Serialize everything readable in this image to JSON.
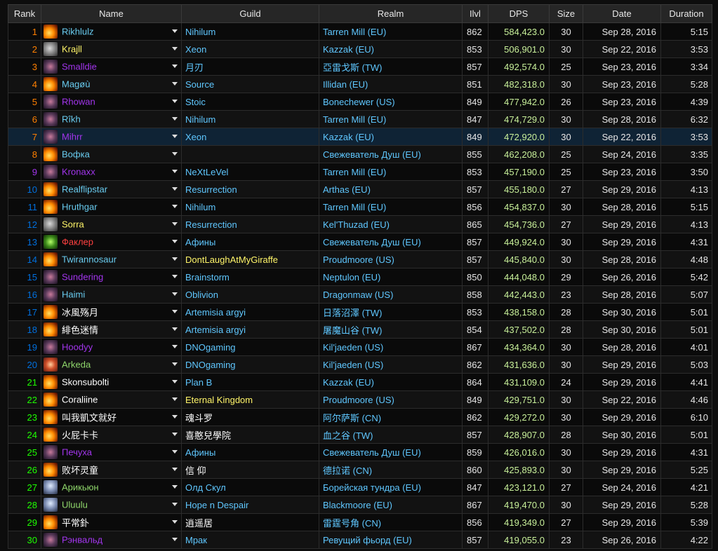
{
  "headers": {
    "rank": "Rank",
    "name": "Name",
    "guild": "Guild",
    "realm": "Realm",
    "ilvl": "Ilvl",
    "dps": "DPS",
    "size": "Size",
    "date": "Date",
    "duration": "Duration"
  },
  "colors": {
    "mage": "#69ccf0",
    "warrior": "#c79c6e",
    "dh": "#a330c9",
    "warlock": "#9482c9",
    "dk": "#c41f3b",
    "priest": "#ffffff",
    "legendary": "#ff8000",
    "rare_guild": "#5fc7ff"
  },
  "rows": [
    {
      "rank": "1",
      "name": "Rikhlulz",
      "name_color": "#69ccf0",
      "icon": "fire-icon",
      "guild": "Nihilum",
      "guild_color": "#5fc7ff",
      "realm": "Tarren Mill (EU)",
      "ilvl": "862",
      "dps": "584,423.0",
      "size": "30",
      "date": "Sep 28, 2016",
      "duration": "5:15"
    },
    {
      "rank": "2",
      "name": "Krajll",
      "name_color": "#fff569",
      "icon": "warrior-helm-icon",
      "guild": "Xeon",
      "guild_color": "#5fc7ff",
      "realm": "Kazzak (EU)",
      "ilvl": "853",
      "dps": "506,901.0",
      "size": "30",
      "date": "Sep 22, 2016",
      "duration": "3:53"
    },
    {
      "rank": "3",
      "name": "Smalldie",
      "name_color": "#a335ee",
      "icon": "demon-hunter-icon",
      "guild": "月刃",
      "guild_color": "#5fc7ff",
      "realm": "亞雷戈斯 (TW)",
      "ilvl": "857",
      "dps": "492,574.0",
      "size": "25",
      "date": "Sep 23, 2016",
      "duration": "3:34"
    },
    {
      "rank": "4",
      "name": "Magøù",
      "name_color": "#69ccf0",
      "icon": "fire-icon",
      "guild": "Source",
      "guild_color": "#5fc7ff",
      "realm": "Illidan (EU)",
      "ilvl": "851",
      "dps": "482,318.0",
      "size": "30",
      "date": "Sep 23, 2016",
      "duration": "5:28"
    },
    {
      "rank": "5",
      "name": "Rhowan",
      "name_color": "#a335ee",
      "icon": "demon-hunter-icon",
      "guild": "Stoic",
      "guild_color": "#5fc7ff",
      "realm": "Bonechewer (US)",
      "ilvl": "849",
      "dps": "477,942.0",
      "size": "26",
      "date": "Sep 23, 2016",
      "duration": "4:39"
    },
    {
      "rank": "6",
      "name": "Rîkh",
      "name_color": "#69ccf0",
      "icon": "demon-hunter-icon",
      "guild": "Nihilum",
      "guild_color": "#5fc7ff",
      "realm": "Tarren Mill (EU)",
      "ilvl": "847",
      "dps": "474,729.0",
      "size": "30",
      "date": "Sep 28, 2016",
      "duration": "6:32"
    },
    {
      "rank": "7",
      "name": "Mihrr",
      "name_color": "#a335ee",
      "icon": "demon-hunter-icon",
      "guild": "Xeon",
      "guild_color": "#5fc7ff",
      "realm": "Kazzak (EU)",
      "ilvl": "849",
      "dps": "472,920.0",
      "size": "30",
      "date": "Sep 22, 2016",
      "duration": "3:53",
      "highlight": true
    },
    {
      "rank": "8",
      "name": "Вофка",
      "name_color": "#69ccf0",
      "icon": "fire-icon",
      "guild": "",
      "guild_color": "#5fc7ff",
      "realm": "Свежеватель Душ (EU)",
      "ilvl": "855",
      "dps": "462,208.0",
      "size": "25",
      "date": "Sep 24, 2016",
      "duration": "3:35"
    },
    {
      "rank": "9",
      "name": "Kronaxx",
      "name_color": "#a335ee",
      "icon": "demon-hunter-icon",
      "guild": "NeXtLeVel",
      "guild_color": "#5fc7ff",
      "realm": "Tarren Mill (EU)",
      "ilvl": "853",
      "dps": "457,190.0",
      "size": "25",
      "date": "Sep 23, 2016",
      "duration": "3:50"
    },
    {
      "rank": "10",
      "name": "Realflipstar",
      "name_color": "#69ccf0",
      "icon": "fire-icon",
      "guild": "Resurrection",
      "guild_color": "#5fc7ff",
      "realm": "Arthas (EU)",
      "ilvl": "857",
      "dps": "455,180.0",
      "size": "27",
      "date": "Sep 29, 2016",
      "duration": "4:13"
    },
    {
      "rank": "11",
      "name": "Hruthgar",
      "name_color": "#69ccf0",
      "icon": "fire-icon",
      "guild": "Nihilum",
      "guild_color": "#5fc7ff",
      "realm": "Tarren Mill (EU)",
      "ilvl": "856",
      "dps": "454,837.0",
      "size": "30",
      "date": "Sep 28, 2016",
      "duration": "5:15"
    },
    {
      "rank": "12",
      "name": "Sorra",
      "name_color": "#fff569",
      "icon": "warrior-helm-icon",
      "guild": "Resurrection",
      "guild_color": "#5fc7ff",
      "realm": "Kel'Thuzad (EU)",
      "ilvl": "865",
      "dps": "454,736.0",
      "size": "27",
      "date": "Sep 29, 2016",
      "duration": "4:13"
    },
    {
      "rank": "13",
      "name": "Факлер",
      "name_color": "#ff4040",
      "icon": "warlock-icon",
      "guild": "Афины",
      "guild_color": "#5fc7ff",
      "realm": "Свежеватель Душ (EU)",
      "ilvl": "857",
      "dps": "449,924.0",
      "size": "30",
      "date": "Sep 29, 2016",
      "duration": "4:31"
    },
    {
      "rank": "14",
      "name": "Twirannosaur",
      "name_color": "#69ccf0",
      "icon": "fire-icon",
      "guild": "DontLaughAtMyGiraffe",
      "guild_color": "#fff569",
      "realm": "Proudmoore (US)",
      "ilvl": "857",
      "dps": "445,840.0",
      "size": "30",
      "date": "Sep 28, 2016",
      "duration": "4:48"
    },
    {
      "rank": "15",
      "name": "Sundering",
      "name_color": "#a335ee",
      "icon": "demon-hunter-icon",
      "guild": "Brainstorm",
      "guild_color": "#5fc7ff",
      "realm": "Neptulon (EU)",
      "ilvl": "850",
      "dps": "444,048.0",
      "size": "29",
      "date": "Sep 26, 2016",
      "duration": "5:42"
    },
    {
      "rank": "16",
      "name": "Haimi",
      "name_color": "#69ccf0",
      "icon": "demon-hunter-icon",
      "guild": "Oblivion",
      "guild_color": "#5fc7ff",
      "realm": "Dragonmaw (US)",
      "ilvl": "858",
      "dps": "442,443.0",
      "size": "23",
      "date": "Sep 28, 2016",
      "duration": "5:07"
    },
    {
      "rank": "17",
      "name": "冰風殇月",
      "name_color": "#ffffff",
      "icon": "fire-icon",
      "guild": "Artemisia argyi",
      "guild_color": "#5fc7ff",
      "realm": "日落沼澤 (TW)",
      "ilvl": "853",
      "dps": "438,158.0",
      "size": "28",
      "date": "Sep 30, 2016",
      "duration": "5:01"
    },
    {
      "rank": "18",
      "name": "緋色迷情",
      "name_color": "#ffffff",
      "icon": "fire-icon",
      "guild": "Artemisia argyi",
      "guild_color": "#5fc7ff",
      "realm": "屠魔山谷 (TW)",
      "ilvl": "854",
      "dps": "437,502.0",
      "size": "28",
      "date": "Sep 30, 2016",
      "duration": "5:01"
    },
    {
      "rank": "19",
      "name": "Hoodyy",
      "name_color": "#a335ee",
      "icon": "demon-hunter-icon",
      "guild": "DNOgaming",
      "guild_color": "#5fc7ff",
      "realm": "Kil'jaeden (US)",
      "ilvl": "867",
      "dps": "434,364.0",
      "size": "30",
      "date": "Sep 28, 2016",
      "duration": "4:01"
    },
    {
      "rank": "20",
      "name": "Arkeda",
      "name_color": "#8fd66b",
      "icon": "arcane-icon",
      "guild": "DNOgaming",
      "guild_color": "#5fc7ff",
      "realm": "Kil'jaeden (US)",
      "ilvl": "862",
      "dps": "431,636.0",
      "size": "30",
      "date": "Sep 29, 2016",
      "duration": "5:03"
    },
    {
      "rank": "21",
      "name": "Skonsubolti",
      "name_color": "#ffffff",
      "icon": "fire-icon",
      "guild": "Plan B",
      "guild_color": "#5fc7ff",
      "realm": "Kazzak (EU)",
      "ilvl": "864",
      "dps": "431,109.0",
      "size": "24",
      "date": "Sep 29, 2016",
      "duration": "4:41"
    },
    {
      "rank": "22",
      "name": "Coraliine",
      "name_color": "#ffffff",
      "icon": "fire-icon",
      "guild": "Eternal Kingdom",
      "guild_color": "#fff569",
      "realm": "Proudmoore (US)",
      "ilvl": "849",
      "dps": "429,751.0",
      "size": "30",
      "date": "Sep 22, 2016",
      "duration": "4:46"
    },
    {
      "rank": "23",
      "name": "叫我凱文就好",
      "name_color": "#ffffff",
      "icon": "fire-icon",
      "guild": "魂斗罗",
      "guild_color": "#ffffff",
      "realm": "阿尔萨斯 (CN)",
      "ilvl": "862",
      "dps": "429,272.0",
      "size": "30",
      "date": "Sep 29, 2016",
      "duration": "6:10"
    },
    {
      "rank": "24",
      "name": "火屁卡卡",
      "name_color": "#ffffff",
      "icon": "fire-icon",
      "guild": "喜憨兒學院",
      "guild_color": "#ffffff",
      "realm": "血之谷 (TW)",
      "ilvl": "857",
      "dps": "428,907.0",
      "size": "28",
      "date": "Sep 30, 2016",
      "duration": "5:01"
    },
    {
      "rank": "25",
      "name": "Печуха",
      "name_color": "#a335ee",
      "icon": "demon-hunter-icon",
      "guild": "Афины",
      "guild_color": "#5fc7ff",
      "realm": "Свежеватель Душ (EU)",
      "ilvl": "859",
      "dps": "426,016.0",
      "size": "30",
      "date": "Sep 29, 2016",
      "duration": "4:31"
    },
    {
      "rank": "26",
      "name": "败坏灵童",
      "name_color": "#ffffff",
      "icon": "fire-icon",
      "guild": "信 仰",
      "guild_color": "#ffffff",
      "realm": "德拉诺 (CN)",
      "ilvl": "860",
      "dps": "425,893.0",
      "size": "30",
      "date": "Sep 29, 2016",
      "duration": "5:25"
    },
    {
      "rank": "27",
      "name": "Арикьюн",
      "name_color": "#8fd66b",
      "icon": "frost-icon",
      "guild": "Олд Скул",
      "guild_color": "#5fc7ff",
      "realm": "Борейская тундра (EU)",
      "ilvl": "847",
      "dps": "423,121.0",
      "size": "27",
      "date": "Sep 24, 2016",
      "duration": "4:21"
    },
    {
      "rank": "28",
      "name": "Uluulu",
      "name_color": "#8fd66b",
      "icon": "frost-icon",
      "guild": "Hope n Despair",
      "guild_color": "#5fc7ff",
      "realm": "Blackmoore (EU)",
      "ilvl": "867",
      "dps": "419,470.0",
      "size": "30",
      "date": "Sep 29, 2016",
      "duration": "5:28"
    },
    {
      "rank": "29",
      "name": "平常釙",
      "name_color": "#ffffff",
      "icon": "fire-icon",
      "guild": "逍遥居",
      "guild_color": "#ffffff",
      "realm": "雷霆号角 (CN)",
      "ilvl": "856",
      "dps": "419,349.0",
      "size": "27",
      "date": "Sep 29, 2016",
      "duration": "5:39"
    },
    {
      "rank": "30",
      "name": "Рэнвальд",
      "name_color": "#a335ee",
      "icon": "demon-hunter-icon",
      "guild": "Мрак",
      "guild_color": "#5fc7ff",
      "realm": "Ревущий фьорд (EU)",
      "ilvl": "857",
      "dps": "419,055.0",
      "size": "23",
      "date": "Sep 26, 2016",
      "duration": "4:22"
    }
  ]
}
